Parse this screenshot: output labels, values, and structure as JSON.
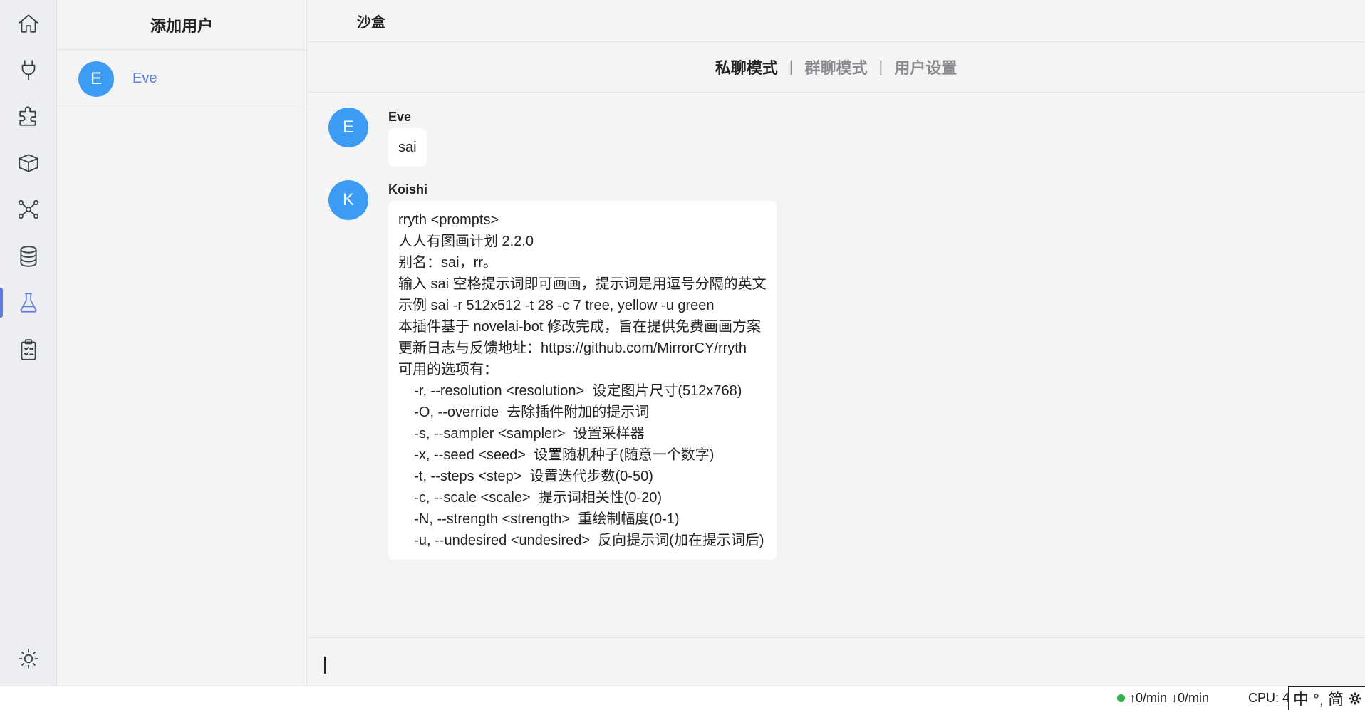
{
  "sidebar": {
    "active_index": 6,
    "items": [
      {
        "icon": "home-icon"
      },
      {
        "icon": "plug-icon"
      },
      {
        "icon": "puzzle-icon"
      },
      {
        "icon": "package-icon"
      },
      {
        "icon": "network-icon"
      },
      {
        "icon": "database-icon"
      },
      {
        "icon": "flask-icon"
      },
      {
        "icon": "clipboard-icon"
      }
    ],
    "bottom_icon": "sun-icon"
  },
  "user_panel": {
    "title": "添加用户",
    "users": [
      {
        "initial": "E",
        "name": "Eve"
      }
    ]
  },
  "header": {
    "title": "沙盒"
  },
  "tabs": [
    {
      "label": "私聊模式",
      "active": true
    },
    {
      "label": "群聊模式",
      "active": false
    },
    {
      "label": "用户设置",
      "active": false
    }
  ],
  "tab_separator": "|",
  "messages": [
    {
      "initial": "E",
      "author": "Eve",
      "lines": [
        "sai"
      ]
    },
    {
      "initial": "K",
      "author": "Koishi",
      "lines": [
        "rryth <prompts>",
        "人人有图画计划 2.2.0",
        "别名：sai，rr。",
        "输入 sai 空格提示词即可画画，提示词是用逗号分隔的英文",
        "示例 sai -r 512x512 -t 28 -c 7 tree, yellow -u green",
        "本插件基于 novelai-bot 修改完成，旨在提供免费画画方案",
        "更新日志与反馈地址：https://github.com/MirrorCY/rryth",
        "可用的选项有：",
        "    -r, --resolution <resolution>  设定图片尺寸(512x768)",
        "    -O, --override  去除插件附加的提示词",
        "    -s, --sampler <sampler>  设置采样器",
        "    -x, --seed <seed>  设置随机种子(随意一个数字)",
        "    -t, --steps <step>  设置迭代步数(0-50)",
        "    -c, --scale <scale>  提示词相关性(0-20)",
        "    -N, --strength <strength>  重绘制幅度(0-1)",
        "    -u, --undesired <undesired>  反向提示词(加在提示词后)"
      ]
    }
  ],
  "status_bar": {
    "upload": "0/min",
    "download": "0/min",
    "cpu": "CPU: 4",
    "ime": "中 °, 简",
    "online_color": "#31b14a"
  },
  "colors": {
    "accent": "#5e7ce0",
    "avatar": "#3c9cf4"
  }
}
